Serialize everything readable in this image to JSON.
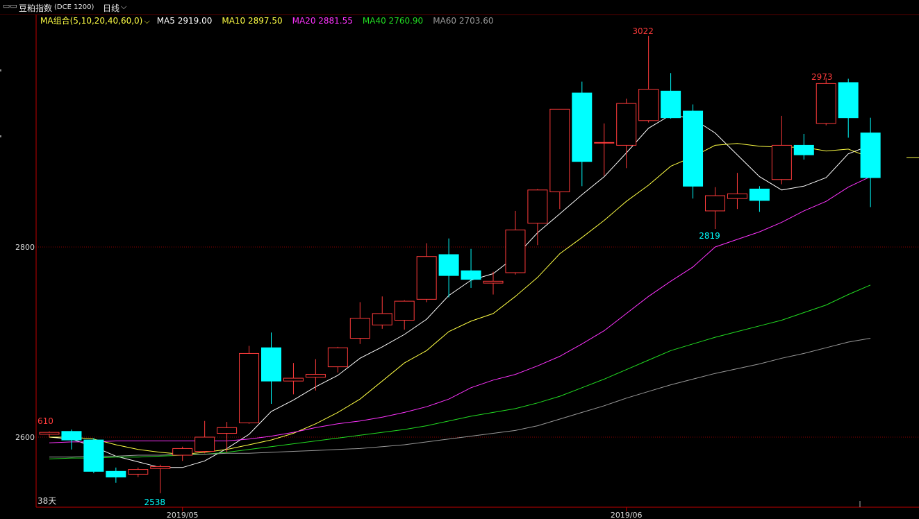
{
  "toolbar": {
    "window_icon": "window-icon",
    "instrument": "豆粕指数",
    "exchange_code": "(DCE 1200)",
    "period": "日线",
    "period_dropdown_icon": "chevron-down-icon"
  },
  "ma_legend": {
    "group_label": "MA组合(5,10,20,40,60,0)",
    "dropdown_icon": "chevron-down-icon",
    "items": [
      {
        "label": "MA5 2919.00",
        "color": "#ffffff"
      },
      {
        "label": "MA10 2897.50",
        "color": "#ffff44"
      },
      {
        "label": "MA20 2881.55",
        "color": "#ff33ff"
      },
      {
        "label": "MA40 2760.90",
        "color": "#22dd22"
      },
      {
        "label": "MA60 2703.60",
        "color": "#999999"
      }
    ]
  },
  "colors": {
    "up": "#ff3b3b",
    "down": "#00ffff",
    "grid": "#8b0000",
    "axis": "#c00000"
  },
  "chart_data": {
    "type": "candlestick",
    "y_ticks": [
      2600,
      2800
    ],
    "ylim": [
      2530,
      3040
    ],
    "x_labels": [
      {
        "index": 6,
        "label": "2019/05"
      },
      {
        "index": 26,
        "label": "2019/06"
      }
    ],
    "annotations": {
      "left_value": "610",
      "days": "38天",
      "low_label": "2538",
      "low_index": 5,
      "mid_low_label": "2819",
      "mid_low_index": 30,
      "high_label": "3022",
      "high_index": 27,
      "right_high_label": "2973",
      "right_high_index": 35
    },
    "candles": [
      {
        "o": 2603,
        "h": 2606,
        "l": 2600,
        "c": 2605
      },
      {
        "o": 2606,
        "h": 2608,
        "l": 2587,
        "c": 2597
      },
      {
        "o": 2597,
        "h": 2599,
        "l": 2562,
        "c": 2564
      },
      {
        "o": 2564,
        "h": 2568,
        "l": 2552,
        "c": 2558
      },
      {
        "o": 2561,
        "h": 2568,
        "l": 2558,
        "c": 2566
      },
      {
        "o": 2567,
        "h": 2571,
        "l": 2541,
        "c": 2569
      },
      {
        "o": 2581,
        "h": 2590,
        "l": 2575,
        "c": 2588
      },
      {
        "o": 2585,
        "h": 2617,
        "l": 2583,
        "c": 2600
      },
      {
        "o": 2604,
        "h": 2616,
        "l": 2584,
        "c": 2610
      },
      {
        "o": 2615,
        "h": 2696,
        "l": 2614,
        "c": 2688
      },
      {
        "o": 2694,
        "h": 2710,
        "l": 2635,
        "c": 2659
      },
      {
        "o": 2659,
        "h": 2678,
        "l": 2645,
        "c": 2662
      },
      {
        "o": 2663,
        "h": 2682,
        "l": 2649,
        "c": 2666
      },
      {
        "o": 2674,
        "h": 2695,
        "l": 2668,
        "c": 2694
      },
      {
        "o": 2704,
        "h": 2742,
        "l": 2698,
        "c": 2725
      },
      {
        "o": 2718,
        "h": 2748,
        "l": 2714,
        "c": 2730
      },
      {
        "o": 2723,
        "h": 2744,
        "l": 2713,
        "c": 2743
      },
      {
        "o": 2745,
        "h": 2804,
        "l": 2742,
        "c": 2790
      },
      {
        "o": 2792,
        "h": 2809,
        "l": 2747,
        "c": 2770
      },
      {
        "o": 2775,
        "h": 2798,
        "l": 2757,
        "c": 2766
      },
      {
        "o": 2762,
        "h": 2774,
        "l": 2750,
        "c": 2764
      },
      {
        "o": 2773,
        "h": 2838,
        "l": 2771,
        "c": 2818
      },
      {
        "o": 2825,
        "h": 2861,
        "l": 2802,
        "c": 2860
      },
      {
        "o": 2858,
        "h": 2945,
        "l": 2840,
        "c": 2945
      },
      {
        "o": 2962,
        "h": 2974,
        "l": 2864,
        "c": 2890
      },
      {
        "o": 2910,
        "h": 2930,
        "l": 2875,
        "c": 2910
      },
      {
        "o": 2907,
        "h": 2956,
        "l": 2883,
        "c": 2951
      },
      {
        "o": 2933,
        "h": 3022,
        "l": 2931,
        "c": 2966
      },
      {
        "o": 2964,
        "h": 2983,
        "l": 2935,
        "c": 2936
      },
      {
        "o": 2943,
        "h": 2950,
        "l": 2851,
        "c": 2864
      },
      {
        "o": 2838,
        "h": 2863,
        "l": 2819,
        "c": 2854
      },
      {
        "o": 2851,
        "h": 2878,
        "l": 2840,
        "c": 2856
      },
      {
        "o": 2861,
        "h": 2864,
        "l": 2837,
        "c": 2849
      },
      {
        "o": 2871,
        "h": 2938,
        "l": 2866,
        "c": 2907
      },
      {
        "o": 2907,
        "h": 2919,
        "l": 2892,
        "c": 2897
      },
      {
        "o": 2930,
        "h": 2978,
        "l": 2928,
        "c": 2972
      },
      {
        "o": 2973,
        "h": 2977,
        "l": 2915,
        "c": 2936
      },
      {
        "o": 2920,
        "h": 2936,
        "l": 2842,
        "c": 2873
      }
    ],
    "series": [
      {
        "name": "MA5",
        "color": "#ffffff",
        "values": [
          2600,
          2598,
          2590,
          2580,
          2574,
          2568,
          2568,
          2575,
          2588,
          2603,
          2627,
          2639,
          2653,
          2665,
          2683,
          2695,
          2708,
          2724,
          2749,
          2765,
          2772,
          2790,
          2815,
          2835,
          2855,
          2874,
          2899,
          2925,
          2939,
          2935,
          2920,
          2897,
          2874,
          2860,
          2864,
          2873,
          2898,
          2907
        ]
      },
      {
        "name": "MA10",
        "color": "#ffff44",
        "values": [
          2600,
          2600,
          2598,
          2592,
          2587,
          2584,
          2582,
          2584,
          2587,
          2592,
          2597,
          2604,
          2614,
          2626,
          2640,
          2659,
          2678,
          2691,
          2711,
          2722,
          2730,
          2748,
          2768,
          2793,
          2810,
          2828,
          2848,
          2865,
          2885,
          2895,
          2907,
          2909,
          2906,
          2905,
          2905,
          2901,
          2903,
          2894
        ]
      },
      {
        "name": "MA20",
        "color": "#ff33ff",
        "values": [
          2594,
          2595,
          2595,
          2596,
          2596,
          2596,
          2596,
          2596,
          2596,
          2598,
          2601,
          2605,
          2610,
          2614,
          2617,
          2621,
          2626,
          2632,
          2640,
          2652,
          2660,
          2666,
          2675,
          2685,
          2698,
          2712,
          2730,
          2748,
          2764,
          2779,
          2800,
          2808,
          2816,
          2826,
          2838,
          2848,
          2863,
          2874
        ]
      },
      {
        "name": "MA40",
        "color": "#22dd22",
        "values": [
          2577,
          2578,
          2578,
          2579,
          2579,
          2580,
          2581,
          2582,
          2584,
          2587,
          2590,
          2593,
          2596,
          2599,
          2602,
          2605,
          2608,
          2612,
          2617,
          2622,
          2626,
          2630,
          2636,
          2643,
          2652,
          2661,
          2671,
          2681,
          2691,
          2698,
          2705,
          2711,
          2717,
          2723,
          2731,
          2739,
          2750,
          2760
        ]
      },
      {
        "name": "MA60",
        "color": "#999999",
        "values": [
          2579,
          2579,
          2580,
          2580,
          2581,
          2581,
          2582,
          2582,
          2583,
          2583,
          2584,
          2585,
          2586,
          2587,
          2588,
          2590,
          2592,
          2595,
          2598,
          2601,
          2604,
          2607,
          2612,
          2619,
          2626,
          2633,
          2641,
          2648,
          2655,
          2661,
          2667,
          2672,
          2677,
          2683,
          2688,
          2694,
          2700,
          2704
        ]
      }
    ],
    "last_ma10_extension": 2894
  }
}
